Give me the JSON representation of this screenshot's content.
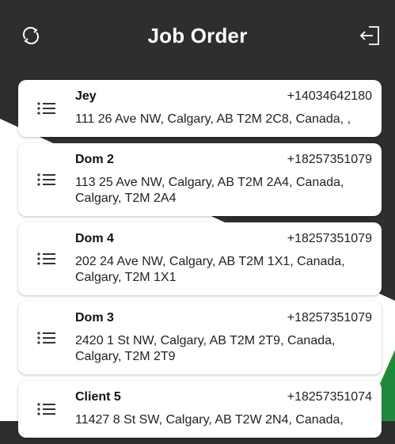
{
  "header": {
    "title": "Job Order",
    "left_icon": "refresh-icon",
    "right_icon": "logout-icon"
  },
  "colors": {
    "background": "#2e2e2e",
    "card": "#ffffff",
    "accent_green": "#1f8a3c"
  },
  "jobs": [
    {
      "name": "Jey",
      "phone": "+14034642180",
      "address": "111 26 Ave NW, Calgary, AB T2M 2C8, Canada, ,"
    },
    {
      "name": "Dom 2",
      "phone": "+18257351079",
      "address": "113 25 Ave NW, Calgary, AB T2M 2A4, Canada, Calgary, T2M 2A4"
    },
    {
      "name": "Dom 4",
      "phone": "+18257351079",
      "address": "202 24 Ave NW, Calgary, AB T2M 1X1, Canada, Calgary, T2M 1X1"
    },
    {
      "name": "Dom 3",
      "phone": "+18257351079",
      "address": "2420 1 St NW, Calgary, AB T2M 2T9, Canada, Calgary, T2M 2T9"
    },
    {
      "name": "Client 5",
      "phone": "+18257351074",
      "address": "11427 8 St SW, Calgary, AB T2W 2N4, Canada,"
    }
  ]
}
